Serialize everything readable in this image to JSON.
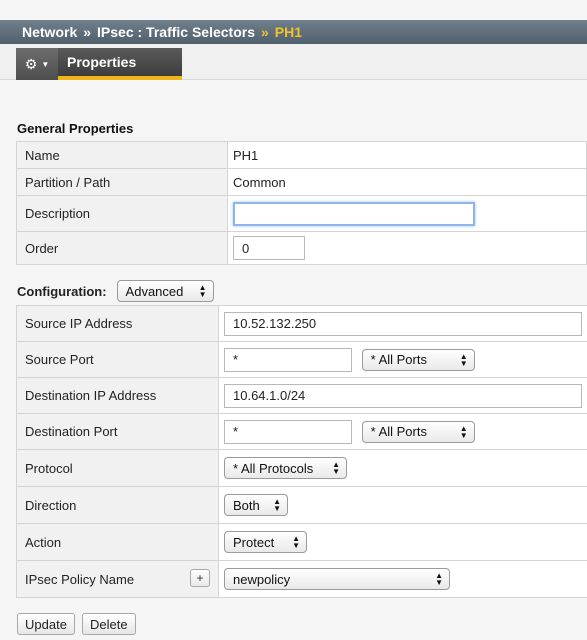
{
  "breadcrumb": {
    "items": [
      "Network",
      "IPsec : Traffic Selectors"
    ],
    "separator": "»",
    "current": "PH1"
  },
  "tabs": {
    "gear_icon": "gear-icon",
    "active_tab": "Properties"
  },
  "general": {
    "title": "General Properties",
    "name_label": "Name",
    "name_value": "PH1",
    "partition_label": "Partition / Path",
    "partition_value": "Common",
    "description_label": "Description",
    "description_value": "",
    "order_label": "Order",
    "order_value": "0"
  },
  "configuration": {
    "label": "Configuration:",
    "mode": "Advanced",
    "source_ip_label": "Source IP Address",
    "source_ip_value": "10.52.132.250",
    "source_port_label": "Source Port",
    "source_port_value": "*",
    "source_port_select": "* All Ports",
    "dest_ip_label": "Destination IP Address",
    "dest_ip_value": "10.64.1.0/24",
    "dest_port_label": "Destination Port",
    "dest_port_value": "*",
    "dest_port_select": "* All Ports",
    "protocol_label": "Protocol",
    "protocol_value": "* All Protocols",
    "direction_label": "Direction",
    "direction_value": "Both",
    "action_label": "Action",
    "action_value": "Protect",
    "policy_label": "IPsec Policy Name",
    "policy_add": "+",
    "policy_value": "newpolicy"
  },
  "actions": {
    "update": "Update",
    "delete": "Delete"
  },
  "colors": {
    "breadcrumb_current": "#f2c22a",
    "tab_underline": "#f2b41b"
  }
}
